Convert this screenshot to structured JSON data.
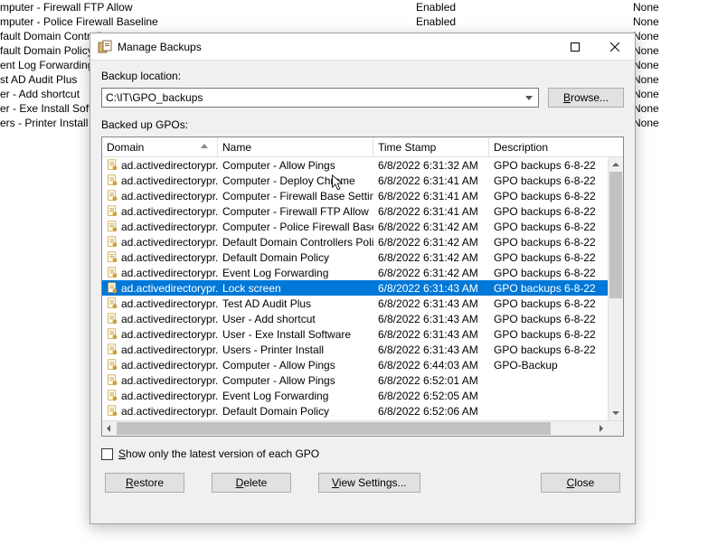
{
  "background_rows": [
    {
      "name": "mputer - Firewall FTP Allow",
      "state": "Enabled",
      "filter": "None"
    },
    {
      "name": "mputer - Police Firewall Baseline",
      "state": "Enabled",
      "filter": "None"
    },
    {
      "name": "fault Domain Controlle",
      "state": "",
      "filter": "None"
    },
    {
      "name": "fault Domain Policy",
      "state": "",
      "filter": "None"
    },
    {
      "name": "ent Log Forwarding",
      "state": "",
      "filter": "None"
    },
    {
      "name": "st AD Audit Plus",
      "state": "",
      "filter": "None"
    },
    {
      "name": "er - Add shortcut",
      "state": "",
      "filter": "None"
    },
    {
      "name": "er - Exe Install Softwa",
      "state": "",
      "filter": "None"
    },
    {
      "name": "ers - Printer Install",
      "state": "",
      "filter": "None"
    }
  ],
  "dialog": {
    "title": "Manage Backups",
    "backup_location_label": "Backup location:",
    "backup_location_value": "C:\\IT\\GPO_backups",
    "browse_label": "Browse...",
    "backed_up_label": "Backed up GPOs:",
    "columns": {
      "domain": "Domain",
      "name": "Name",
      "time": "Time Stamp",
      "desc": "Description"
    },
    "rows": [
      {
        "domain": "ad.activedirectorypr...",
        "name": "Computer - Allow Pings",
        "time": "6/8/2022 6:31:32 AM",
        "desc": "GPO backups 6-8-22",
        "selected": false
      },
      {
        "domain": "ad.activedirectorypr...",
        "name": "Computer - Deploy Chrome",
        "time": "6/8/2022 6:31:41 AM",
        "desc": "GPO backups 6-8-22",
        "selected": false
      },
      {
        "domain": "ad.activedirectorypr...",
        "name": "Computer - Firewall Base Settings",
        "time": "6/8/2022 6:31:41 AM",
        "desc": "GPO backups 6-8-22",
        "selected": false
      },
      {
        "domain": "ad.activedirectorypr...",
        "name": "Computer - Firewall FTP Allow",
        "time": "6/8/2022 6:31:41 AM",
        "desc": "GPO backups 6-8-22",
        "selected": false
      },
      {
        "domain": "ad.activedirectorypr...",
        "name": "Computer - Police Firewall Baseline",
        "time": "6/8/2022 6:31:42 AM",
        "desc": "GPO backups 6-8-22",
        "selected": false
      },
      {
        "domain": "ad.activedirectorypr...",
        "name": "Default Domain Controllers Policy",
        "time": "6/8/2022 6:31:42 AM",
        "desc": "GPO backups 6-8-22",
        "selected": false
      },
      {
        "domain": "ad.activedirectorypr...",
        "name": "Default Domain Policy",
        "time": "6/8/2022 6:31:42 AM",
        "desc": "GPO backups 6-8-22",
        "selected": false
      },
      {
        "domain": "ad.activedirectorypr...",
        "name": "Event Log Forwarding",
        "time": "6/8/2022 6:31:42 AM",
        "desc": "GPO backups 6-8-22",
        "selected": false
      },
      {
        "domain": "ad.activedirectorypr...",
        "name": "Lock screen",
        "time": "6/8/2022 6:31:43 AM",
        "desc": "GPO backups 6-8-22",
        "selected": true
      },
      {
        "domain": "ad.activedirectorypr...",
        "name": "Test AD Audit Plus",
        "time": "6/8/2022 6:31:43 AM",
        "desc": "GPO backups 6-8-22",
        "selected": false
      },
      {
        "domain": "ad.activedirectorypr...",
        "name": "User - Add shortcut",
        "time": "6/8/2022 6:31:43 AM",
        "desc": "GPO backups 6-8-22",
        "selected": false
      },
      {
        "domain": "ad.activedirectorypr...",
        "name": "User - Exe Install Software",
        "time": "6/8/2022 6:31:43 AM",
        "desc": "GPO backups 6-8-22",
        "selected": false
      },
      {
        "domain": "ad.activedirectorypr...",
        "name": "Users - Printer Install",
        "time": "6/8/2022 6:31:43 AM",
        "desc": "GPO backups 6-8-22",
        "selected": false
      },
      {
        "domain": "ad.activedirectorypr...",
        "name": "Computer - Allow Pings",
        "time": "6/8/2022 6:44:03 AM",
        "desc": "GPO-Backup",
        "selected": false
      },
      {
        "domain": "ad.activedirectorypr...",
        "name": "Computer - Allow Pings",
        "time": "6/8/2022 6:52:01 AM",
        "desc": "",
        "selected": false
      },
      {
        "domain": "ad.activedirectorypr...",
        "name": "Event Log Forwarding",
        "time": "6/8/2022 6:52:05 AM",
        "desc": "",
        "selected": false
      },
      {
        "domain": "ad.activedirectorypr...",
        "name": "Default Domain Policy",
        "time": "6/8/2022 6:52:06 AM",
        "desc": "",
        "selected": false
      }
    ],
    "show_latest_label": "Show only the latest version of each GPO",
    "restore_label": "Restore",
    "delete_label": "Delete",
    "view_settings_label": "View Settings...",
    "close_label": "Close"
  }
}
